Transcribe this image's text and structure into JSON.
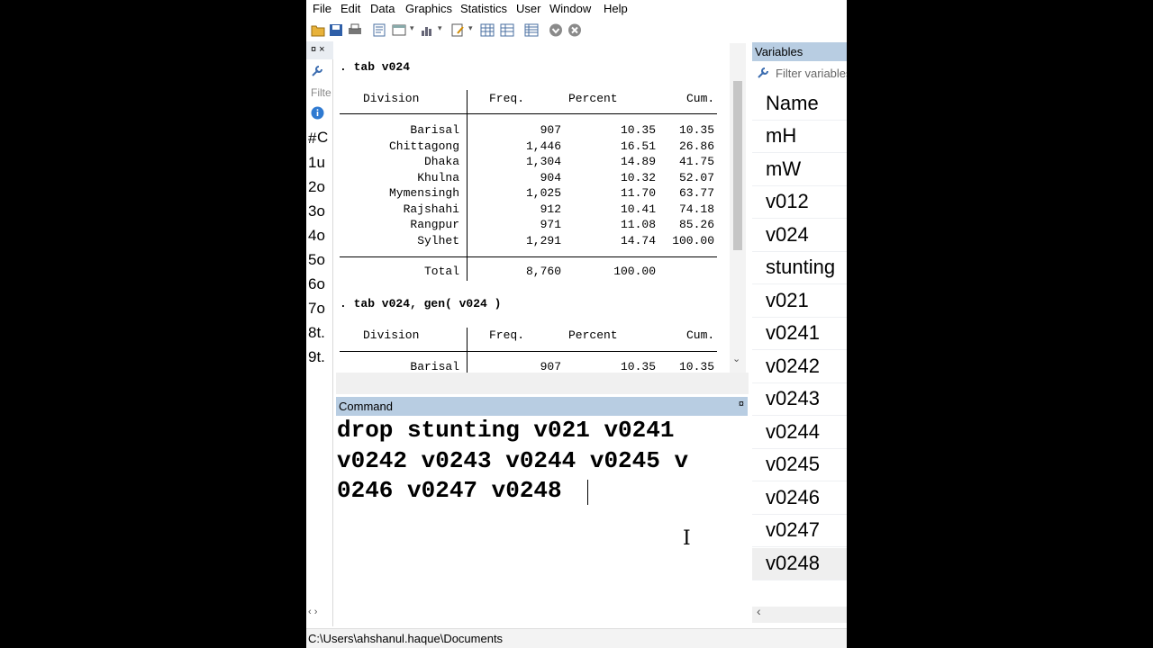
{
  "menu": [
    "File",
    "Edit",
    "Data",
    "Graphics",
    "Statistics",
    "User",
    "Window",
    "Help"
  ],
  "history": {
    "pin": "¤ ×",
    "filter_label": "Filte",
    "col_hash": "#",
    "col_c": "C",
    "rows": [
      "1u",
      "2o",
      "3o",
      "4o",
      "5o",
      "6o",
      "7o",
      "8t.",
      "9t."
    ]
  },
  "results": {
    "cmd1": ". tab v024",
    "cmd2": ". tab v024, gen( v024 )",
    "header": [
      "Division",
      "Freq.",
      "Percent",
      "Cum."
    ],
    "rows": [
      [
        "Barisal",
        "907",
        "10.35",
        "10.35"
      ],
      [
        "Chittagong",
        "1,446",
        "16.51",
        "26.86"
      ],
      [
        "Dhaka",
        "1,304",
        "14.89",
        "41.75"
      ],
      [
        "Khulna",
        "904",
        "10.32",
        "52.07"
      ],
      [
        "Mymensingh",
        "1,025",
        "11.70",
        "63.77"
      ],
      [
        "Rajshahi",
        "912",
        "10.41",
        "74.18"
      ],
      [
        "Rangpur",
        "971",
        "11.08",
        "85.26"
      ],
      [
        "Sylhet",
        "1,291",
        "14.74",
        "100.00"
      ]
    ],
    "total": [
      "Total",
      "8,760",
      "100.00"
    ],
    "row2_partial": [
      "Barisal",
      "907",
      "10.35",
      "10.35"
    ]
  },
  "command": {
    "title": "Command",
    "pin": "¤",
    "lines": [
      "drop stunting v021 v0241",
      "v0242 v0243 v0244 v0245 v",
      "0246 v0247 v0248"
    ]
  },
  "variables": {
    "title": "Variables",
    "filter_placeholder": "Filter variables",
    "column": "Name",
    "items": [
      "mH",
      "mW",
      "v012",
      "v024",
      "stunting",
      "v021",
      "v0241",
      "v0242",
      "v0243",
      "v0244",
      "v0245",
      "v0246",
      "v0247",
      "v0248"
    ]
  },
  "status": {
    "path": "C:\\Users\\ahshanul.haque\\Documents"
  },
  "colors": {
    "panel_header": "#b8cde2",
    "selected_row": "#efefef"
  }
}
